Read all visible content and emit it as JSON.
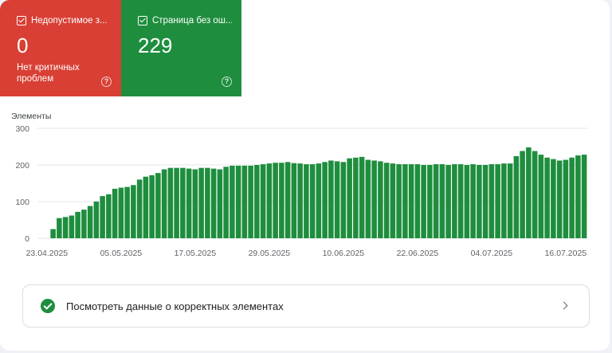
{
  "tiles": [
    {
      "label": "Недопустимое з...",
      "value": "0",
      "desc": "Нет критичных проблем",
      "color": "#d93f34"
    },
    {
      "label": "Страница без ош...",
      "value": "229",
      "desc": "",
      "color": "#1e8e3e"
    }
  ],
  "details": {
    "label": "Посмотреть данные о корректных элементах"
  },
  "chart_data": {
    "type": "bar",
    "ylabel": "Элементы",
    "ylim": [
      0,
      300
    ],
    "yticks": [
      0,
      100,
      200,
      300
    ],
    "x_tick_labels": [
      "23.04.2025",
      "05.05.2025",
      "17.05.2025",
      "29.05.2025",
      "10.06.2025",
      "22.06.2025",
      "04.07.2025",
      "16.07.2025"
    ],
    "x_tick_indices": [
      0,
      12,
      24,
      36,
      48,
      60,
      72,
      84
    ],
    "bar_color": "#1e8e3e",
    "values": [
      0,
      25,
      55,
      58,
      62,
      72,
      78,
      88,
      100,
      115,
      120,
      135,
      138,
      140,
      145,
      160,
      168,
      172,
      178,
      188,
      192,
      192,
      192,
      190,
      188,
      192,
      192,
      190,
      188,
      195,
      198,
      198,
      198,
      198,
      200,
      202,
      204,
      206,
      206,
      208,
      205,
      204,
      202,
      202,
      204,
      208,
      212,
      210,
      208,
      218,
      220,
      222,
      214,
      212,
      210,
      206,
      204,
      202,
      202,
      202,
      202,
      200,
      200,
      202,
      202,
      200,
      202,
      202,
      200,
      202,
      200,
      200,
      202,
      202,
      204,
      204,
      224,
      238,
      248,
      238,
      228,
      220,
      216,
      212,
      214,
      220,
      226,
      228
    ]
  }
}
